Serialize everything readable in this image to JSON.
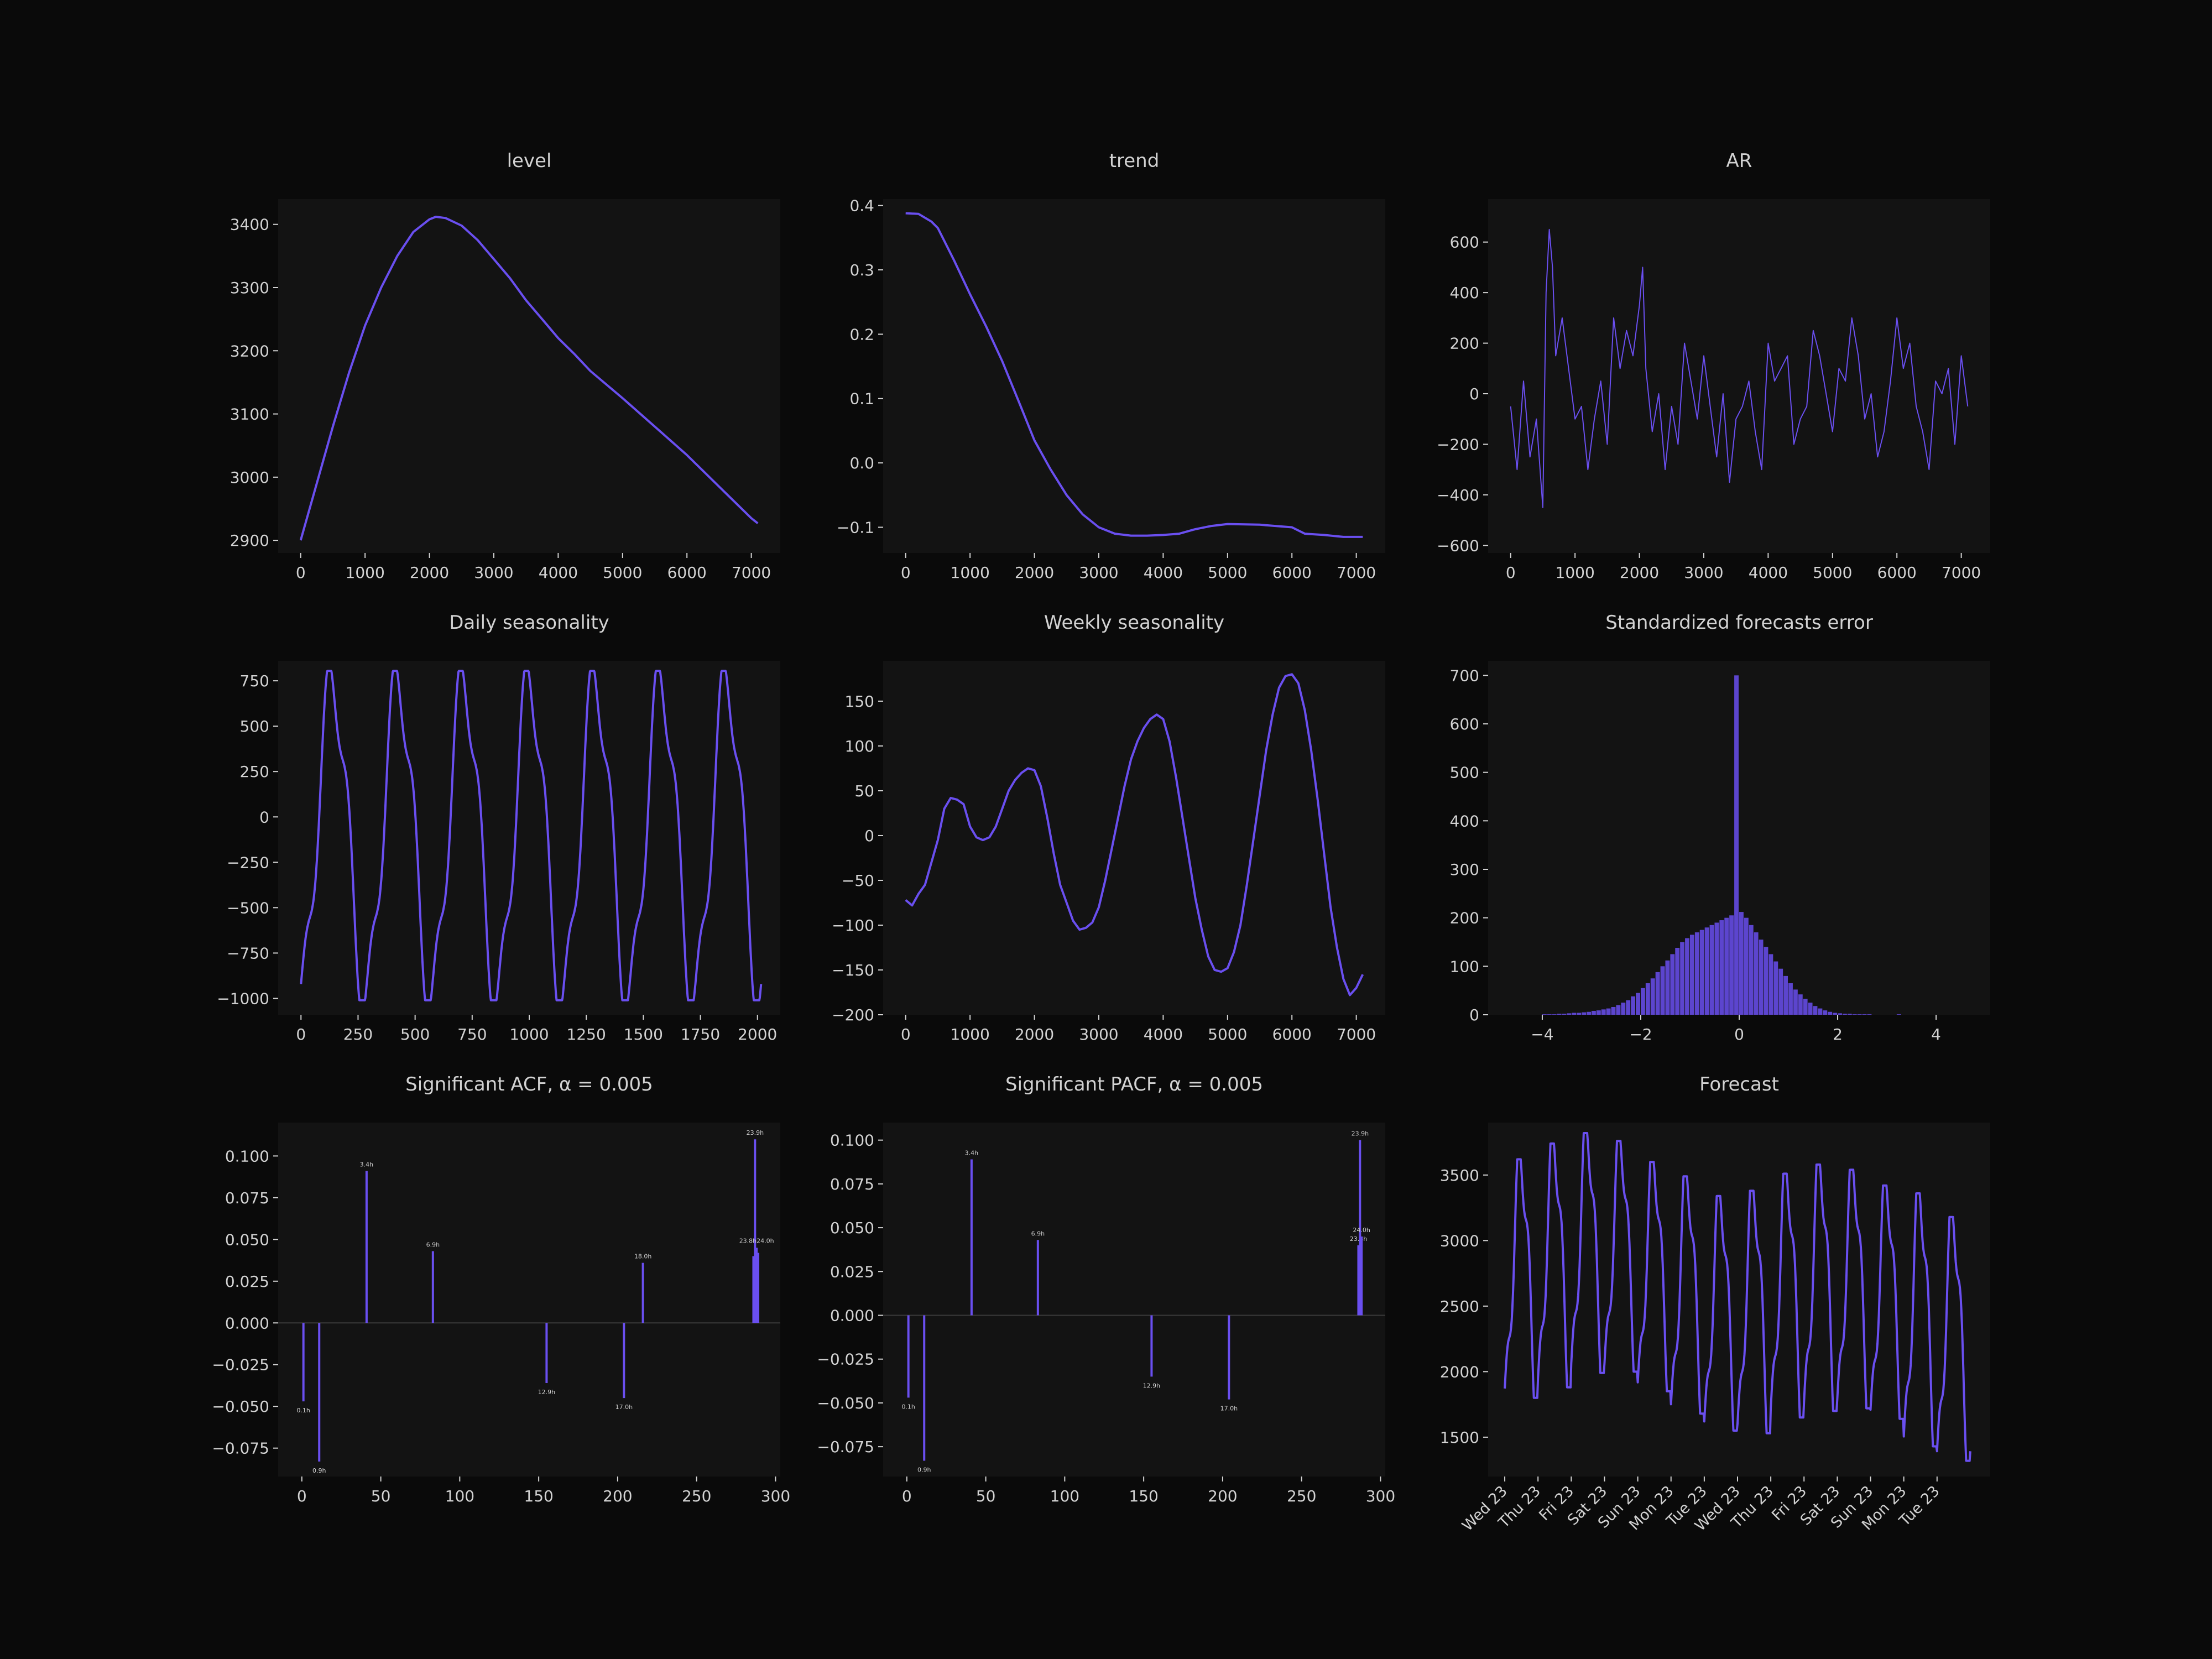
{
  "colors": {
    "background": "#0a0a0a",
    "panel": "#131313",
    "line": "#6a4ff0",
    "text": "#d2d2d2",
    "zero_line": "#3a3a3a"
  },
  "chart_data": [
    {
      "type": "line",
      "title": "level",
      "xlim": [
        -350,
        7450
      ],
      "ylim": [
        2880,
        3440
      ],
      "xticks": [
        0,
        1000,
        2000,
        3000,
        4000,
        5000,
        6000,
        7000
      ],
      "yticks": [
        2900,
        3000,
        3100,
        3200,
        3300,
        3400
      ],
      "series": [
        {
          "x": [
            0,
            250,
            500,
            750,
            1000,
            1250,
            1500,
            1750,
            2000,
            2100,
            2250,
            2500,
            2750,
            3000,
            3250,
            3500,
            3750,
            4000,
            4250,
            4500,
            5000,
            5500,
            6000,
            6500,
            7000,
            7100
          ],
          "values": [
            2900,
            2990,
            3080,
            3165,
            3240,
            3300,
            3350,
            3388,
            3408,
            3412,
            3410,
            3398,
            3375,
            3345,
            3315,
            3280,
            3250,
            3220,
            3195,
            3168,
            3125,
            3080,
            3035,
            2985,
            2935,
            2927
          ]
        }
      ]
    },
    {
      "type": "line",
      "title": "trend",
      "xlim": [
        -350,
        7450
      ],
      "ylim": [
        -0.14,
        0.41
      ],
      "xticks": [
        0,
        1000,
        2000,
        3000,
        4000,
        5000,
        6000,
        7000
      ],
      "yticks": [
        -0.1,
        0.0,
        0.1,
        0.2,
        0.3,
        0.4
      ],
      "series": [
        {
          "x": [
            0,
            200,
            400,
            500,
            750,
            1000,
            1250,
            1500,
            1750,
            2000,
            2250,
            2500,
            2750,
            3000,
            3250,
            3500,
            3750,
            4000,
            4250,
            4500,
            4750,
            5000,
            5500,
            6000,
            6200,
            6500,
            6800,
            7100
          ],
          "values": [
            0.388,
            0.387,
            0.375,
            0.365,
            0.315,
            0.262,
            0.212,
            0.158,
            0.097,
            0.035,
            -0.01,
            -0.05,
            -0.08,
            -0.1,
            -0.11,
            -0.113,
            -0.113,
            -0.112,
            -0.11,
            -0.103,
            -0.098,
            -0.095,
            -0.096,
            -0.1,
            -0.11,
            -0.112,
            -0.115,
            -0.115
          ]
        }
      ]
    },
    {
      "type": "line",
      "title": "AR",
      "xlim": [
        -350,
        7450
      ],
      "ylim": [
        -630,
        770
      ],
      "xticks": [
        0,
        1000,
        2000,
        3000,
        4000,
        5000,
        6000,
        7000
      ],
      "yticks": [
        -600,
        -400,
        -200,
        0,
        200,
        400,
        600
      ],
      "series": [
        {
          "x": [
            0,
            100,
            200,
            300,
            400,
            500,
            550,
            600,
            650,
            700,
            800,
            900,
            1000,
            1100,
            1200,
            1300,
            1400,
            1500,
            1600,
            1700,
            1800,
            1900,
            2000,
            2050,
            2100,
            2200,
            2300,
            2400,
            2500,
            2600,
            2700,
            2800,
            2900,
            3000,
            3100,
            3200,
            3300,
            3400,
            3500,
            3600,
            3700,
            3800,
            3900,
            4000,
            4100,
            4200,
            4300,
            4400,
            4500,
            4600,
            4700,
            4800,
            4900,
            5000,
            5100,
            5200,
            5300,
            5400,
            5500,
            5600,
            5700,
            5800,
            5900,
            6000,
            6100,
            6200,
            6300,
            6400,
            6500,
            6600,
            6700,
            6800,
            6900,
            7000,
            7100
          ],
          "values": [
            -50,
            -300,
            50,
            -250,
            -100,
            -450,
            400,
            650,
            500,
            150,
            300,
            100,
            -100,
            -50,
            -300,
            -100,
            50,
            -200,
            300,
            100,
            250,
            150,
            350,
            500,
            100,
            -150,
            0,
            -300,
            -50,
            -200,
            200,
            50,
            -100,
            150,
            -50,
            -250,
            0,
            -350,
            -100,
            -50,
            50,
            -150,
            -300,
            200,
            50,
            100,
            150,
            -200,
            -100,
            -50,
            250,
            150,
            0,
            -150,
            100,
            50,
            300,
            150,
            -100,
            0,
            -250,
            -150,
            50,
            300,
            100,
            200,
            -50,
            -150,
            -300,
            50,
            0,
            100,
            -200,
            150,
            -50
          ]
        }
      ]
    },
    {
      "type": "line",
      "title": "Daily seasonality",
      "xlim": [
        -100,
        2100
      ],
      "ylim": [
        -1090,
        860
      ],
      "xticks": [
        0,
        250,
        500,
        750,
        1000,
        1250,
        1500,
        1750,
        2000
      ],
      "yticks": [
        -1000,
        -750,
        -500,
        -250,
        0,
        250,
        500,
        750
      ],
      "series": [
        {
          "x": [],
          "values": []
        }
      ]
    },
    {
      "type": "line",
      "title": "Weekly seasonality",
      "xlim": [
        -350,
        7450
      ],
      "ylim": [
        -200,
        195
      ],
      "xticks": [
        0,
        1000,
        2000,
        3000,
        4000,
        5000,
        6000,
        7000
      ],
      "yticks": [
        -200,
        -150,
        -100,
        -50,
        0,
        50,
        100,
        150
      ],
      "series": [
        {
          "x": [
            0,
            100,
            200,
            300,
            400,
            500,
            600,
            700,
            800,
            900,
            1000,
            1100,
            1200,
            1300,
            1400,
            1500,
            1600,
            1700,
            1800,
            1900,
            2000,
            2100,
            2200,
            2300,
            2400,
            2500,
            2600,
            2700,
            2800,
            2900,
            3000,
            3100,
            3200,
            3300,
            3400,
            3500,
            3600,
            3700,
            3800,
            3900,
            4000,
            4100,
            4200,
            4300,
            4400,
            4500,
            4600,
            4700,
            4800,
            4900,
            5000,
            5100,
            5200,
            5300,
            5400,
            5500,
            5600,
            5700,
            5800,
            5900,
            6000,
            6100,
            6200,
            6300,
            6400,
            6500,
            6600,
            6700,
            6800,
            6900,
            7000,
            7100
          ],
          "values": [
            -72,
            -78,
            -65,
            -55,
            -30,
            -5,
            30,
            42,
            40,
            35,
            10,
            -2,
            -5,
            -2,
            10,
            30,
            50,
            62,
            70,
            75,
            73,
            55,
            20,
            -20,
            -55,
            -75,
            -95,
            -105,
            -103,
            -97,
            -80,
            -50,
            -15,
            20,
            55,
            85,
            105,
            120,
            130,
            135,
            130,
            105,
            65,
            20,
            -25,
            -70,
            -105,
            -135,
            -150,
            -152,
            -148,
            -130,
            -100,
            -55,
            -5,
            45,
            95,
            135,
            165,
            178,
            180,
            170,
            140,
            95,
            40,
            -20,
            -80,
            -125,
            -160,
            -178,
            -170,
            -155
          ]
        }
      ]
    },
    {
      "type": "bar",
      "title": "Standardized forecasts error",
      "xlim": [
        -5.1,
        5.1
      ],
      "ylim": [
        0,
        730
      ],
      "xticks": [
        -4,
        -2,
        0,
        2,
        4
      ],
      "yticks": [
        0,
        100,
        200,
        300,
        400,
        500,
        600,
        700
      ],
      "series": [
        {
          "x": [
            -3.95,
            -3.85,
            -3.75,
            -3.65,
            -3.55,
            -3.45,
            -3.35,
            -3.25,
            -3.15,
            -3.05,
            -2.95,
            -2.85,
            -2.75,
            -2.65,
            -2.55,
            -2.45,
            -2.35,
            -2.25,
            -2.15,
            -2.05,
            -1.95,
            -1.85,
            -1.75,
            -1.65,
            -1.55,
            -1.45,
            -1.35,
            -1.25,
            -1.15,
            -1.05,
            -0.95,
            -0.85,
            -0.75,
            -0.65,
            -0.55,
            -0.45,
            -0.35,
            -0.25,
            -0.15,
            -0.05,
            0.05,
            0.15,
            0.25,
            0.35,
            0.45,
            0.55,
            0.65,
            0.75,
            0.85,
            0.95,
            1.05,
            1.15,
            1.25,
            1.35,
            1.45,
            1.55,
            1.65,
            1.75,
            1.85,
            1.95,
            2.05,
            2.15,
            2.25,
            2.35,
            2.45,
            2.55,
            2.65,
            2.75,
            2.85,
            2.95,
            3.05,
            3.15,
            3.25,
            3.35
          ],
          "values": [
            1,
            1,
            1,
            2,
            2,
            3,
            4,
            4,
            5,
            6,
            8,
            9,
            11,
            13,
            16,
            20,
            25,
            30,
            38,
            45,
            55,
            65,
            75,
            88,
            100,
            112,
            125,
            138,
            150,
            158,
            165,
            170,
            175,
            180,
            185,
            190,
            195,
            200,
            205,
            700,
            212,
            200,
            185,
            170,
            155,
            140,
            125,
            110,
            95,
            80,
            65,
            52,
            42,
            33,
            25,
            18,
            13,
            9,
            6,
            4,
            3,
            2,
            2,
            1,
            1,
            1,
            1,
            0,
            0,
            0,
            0,
            0,
            1,
            0
          ]
        }
      ]
    },
    {
      "type": "bar",
      "title": "Significant ACF, α = 0.005",
      "xlim": [
        -15,
        303
      ],
      "ylim": [
        -0.092,
        0.12
      ],
      "xticks": [
        0,
        50,
        100,
        150,
        200,
        250,
        300
      ],
      "yticks": [
        -0.075,
        -0.05,
        -0.025,
        0.0,
        0.025,
        0.05,
        0.075,
        0.1
      ],
      "bars": [
        {
          "x": 1,
          "value": -0.047,
          "label": "0.1h"
        },
        {
          "x": 11,
          "value": -0.083,
          "label": "0.9h"
        },
        {
          "x": 41,
          "value": 0.091,
          "label": "3.4h"
        },
        {
          "x": 83,
          "value": 0.043,
          "label": "6.9h"
        },
        {
          "x": 155,
          "value": -0.036,
          "label": "12.9h"
        },
        {
          "x": 204,
          "value": -0.045,
          "label": "17.0h"
        },
        {
          "x": 216,
          "value": 0.036,
          "label": "18.0h"
        },
        {
          "x": 286,
          "value": 0.04,
          "label": ""
        },
        {
          "x": 287,
          "value": 0.11,
          "label": "23.9h"
        },
        {
          "x": 288,
          "value": 0.045,
          "label": ""
        },
        {
          "x": 289,
          "value": 0.042,
          "label": ""
        }
      ],
      "cluster_label": "23.8h24.0h"
    },
    {
      "type": "bar",
      "title": "Significant PACF, α = 0.005",
      "xlim": [
        -15,
        303
      ],
      "ylim": [
        -0.092,
        0.11
      ],
      "xticks": [
        0,
        50,
        100,
        150,
        200,
        250,
        300
      ],
      "yticks": [
        -0.075,
        -0.05,
        -0.025,
        0.0,
        0.025,
        0.05,
        0.075,
        0.1
      ],
      "bars": [
        {
          "x": 1,
          "value": -0.047,
          "label": "0.1h"
        },
        {
          "x": 11,
          "value": -0.083,
          "label": "0.9h"
        },
        {
          "x": 41,
          "value": 0.089,
          "label": "3.4h"
        },
        {
          "x": 83,
          "value": 0.043,
          "label": "6.9h"
        },
        {
          "x": 155,
          "value": -0.035,
          "label": "12.9h"
        },
        {
          "x": 204,
          "value": -0.048,
          "label": "17.0h"
        },
        {
          "x": 286,
          "value": 0.04,
          "label": "23.8h"
        },
        {
          "x": 287,
          "value": 0.1,
          "label": "23.9h"
        },
        {
          "x": 288,
          "value": 0.045,
          "label": "24.0h"
        }
      ]
    },
    {
      "type": "line",
      "title": "Forecast",
      "xlim": [
        -0.5,
        14.6
      ],
      "ylim": [
        1200,
        3900
      ],
      "xticks": [
        0,
        1,
        2,
        3,
        4,
        5,
        6,
        7,
        8,
        9,
        10,
        11,
        12,
        13
      ],
      "xtick_labels": [
        "Wed 23",
        "Thu 23",
        "Fri 23",
        "Sat 23",
        "Sun 23",
        "Mon 23",
        "Tue 23",
        "Wed 23",
        "Thu 23",
        "Fri 23",
        "Sat 23",
        "Sun 23",
        "Mon 23",
        "Tue 23"
      ],
      "yticks": [
        1500,
        2000,
        2500,
        3000,
        3500
      ],
      "series": [
        {
          "daily_min": [
            1800,
            1880,
            1990,
            2000,
            1850,
            1680,
            1550,
            1530,
            1650,
            1700,
            1720,
            1640,
            1430,
            1320,
            1580
          ],
          "daily_max": [
            3620,
            3740,
            3820,
            3760,
            3600,
            3490,
            3340,
            3380,
            3510,
            3580,
            3540,
            3420,
            3360,
            3180,
            3100
          ]
        }
      ]
    }
  ]
}
